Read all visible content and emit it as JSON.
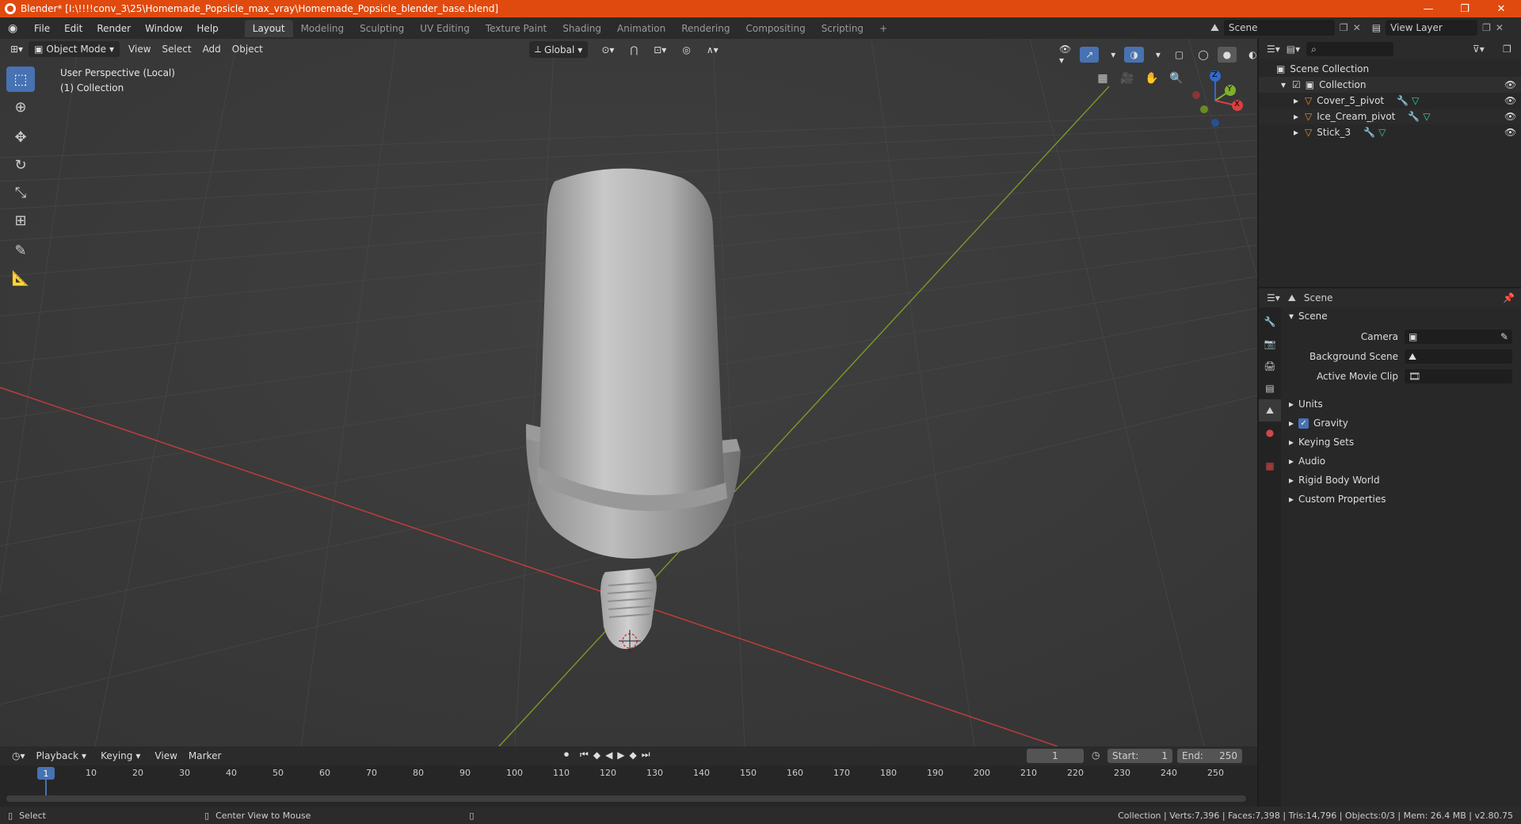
{
  "window": {
    "title": "Blender* [I:\\!!!!conv_3\\25\\Homemade_Popsicle_max_vray\\Homemade_Popsicle_blender_base.blend]",
    "minimize": "—",
    "maximize": "❐",
    "close": "✕"
  },
  "menu": [
    "File",
    "Edit",
    "Render",
    "Window",
    "Help"
  ],
  "workspaces": [
    "Layout",
    "Modeling",
    "Sculpting",
    "UV Editing",
    "Texture Paint",
    "Shading",
    "Animation",
    "Rendering",
    "Compositing",
    "Scripting"
  ],
  "active_workspace": "Layout",
  "add_workspace": "+",
  "scene_selector": {
    "label": "Scene",
    "view_layer": "View Layer"
  },
  "viewport": {
    "mode": "Object Mode",
    "menus": [
      "View",
      "Select",
      "Add",
      "Object"
    ],
    "transform": "Global",
    "info_line1": "User Perspective (Local)",
    "info_line2": "(1) Collection",
    "gizmo_axes": {
      "z": "Z",
      "y": "Y",
      "x": "X"
    }
  },
  "outliner": {
    "root": "Scene Collection",
    "collection": "Collection",
    "items": [
      "Cover_5_pivot",
      "Ice_Cream_pivot",
      "Stick_3"
    ]
  },
  "properties": {
    "context": "Scene",
    "panel_title": "Scene",
    "fields": [
      {
        "label": "Camera"
      },
      {
        "label": "Background Scene"
      },
      {
        "label": "Active Movie Clip"
      }
    ],
    "sections": [
      "Units",
      "Gravity",
      "Keying Sets",
      "Audio",
      "Rigid Body World",
      "Custom Properties"
    ]
  },
  "timeline": {
    "menus": [
      "Playback",
      "Keying",
      "View",
      "Marker"
    ],
    "current_frame": "1",
    "start_label": "Start:",
    "start": "1",
    "end_label": "End:",
    "end": "250",
    "ticks": [
      "10",
      "20",
      "30",
      "40",
      "50",
      "60",
      "70",
      "80",
      "90",
      "100",
      "110",
      "120",
      "130",
      "140",
      "150",
      "160",
      "170",
      "180",
      "190",
      "200",
      "210",
      "220",
      "230",
      "240",
      "250"
    ],
    "playhead_label": "1"
  },
  "status": {
    "left1": "Select",
    "left2": "Center View to Mouse",
    "right": "Collection | Verts:7,396 | Faces:7,398 | Tris:14,796 | Objects:0/3 | Mem: 26.4 MB | v2.80.75"
  },
  "colors": {
    "accent": "#4772b3",
    "title_bar": "#e04a0e",
    "x_axis": "#c93c3c",
    "y_axis": "#7a9a2a"
  }
}
